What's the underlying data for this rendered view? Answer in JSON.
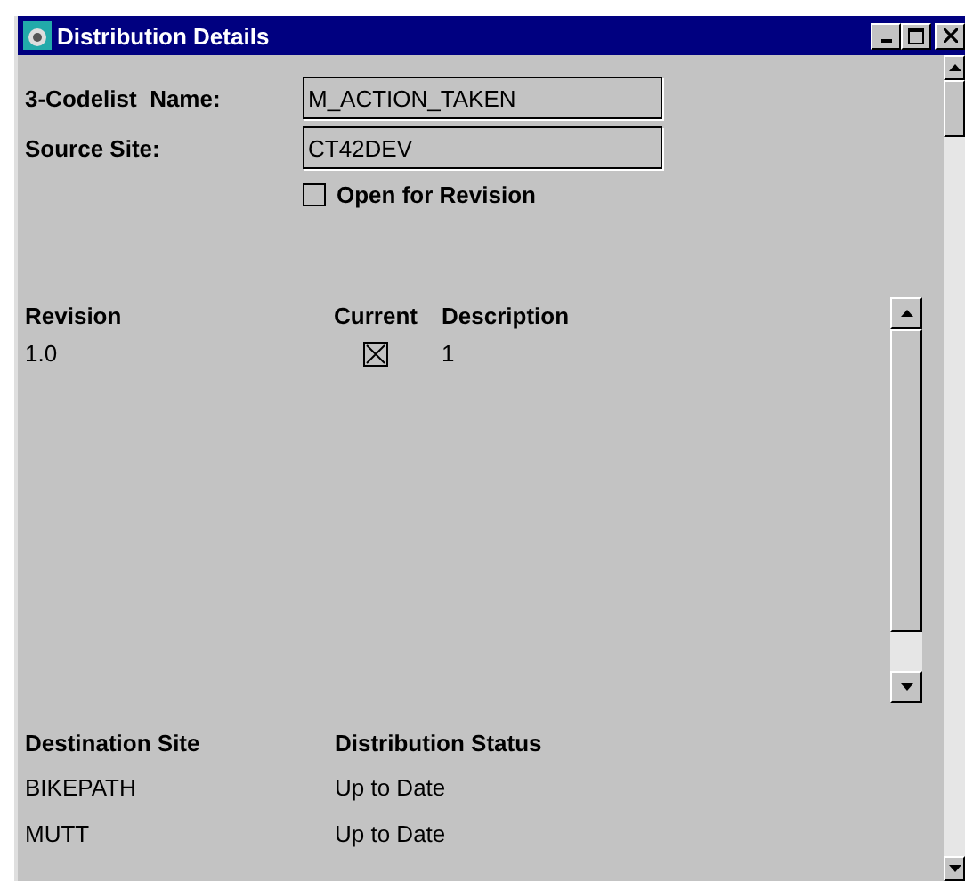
{
  "window": {
    "title": "Distribution Details"
  },
  "fields": [
    {
      "label": "3-Codelist  Name:",
      "value": "M_ACTION_TAKEN"
    },
    {
      "label": "Source Site:",
      "value": "CT42DEV"
    }
  ],
  "open_for_revision": {
    "label": "Open for Revision",
    "checked": false
  },
  "revisions": {
    "columns": [
      "Revision",
      "Current",
      "Description"
    ],
    "rows": [
      {
        "revision": "1.0",
        "current": true,
        "description": "1"
      }
    ]
  },
  "destinations": {
    "columns": [
      "Destination Site",
      "Distribution Status"
    ],
    "rows": [
      {
        "site": "BIKEPATH",
        "status": "Up to Date"
      },
      {
        "site": "MUTT",
        "status": "Up to Date"
      }
    ]
  }
}
